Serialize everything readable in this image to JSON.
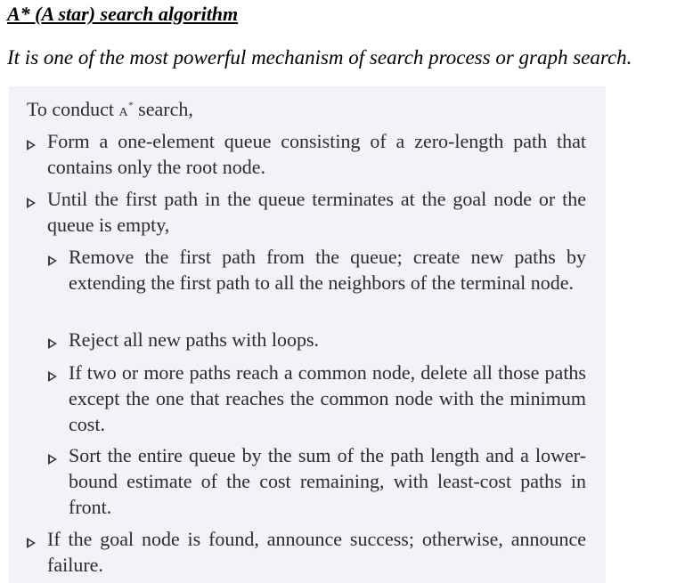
{
  "title": "A* (A star) search algorithm",
  "intro": "It is one of the most powerful mechanism of search process or graph search.",
  "procedure": {
    "heading_pre": "To conduct ",
    "heading_a": "A",
    "heading_star": "*",
    "heading_post": " search,",
    "steps": [
      "Form a one-element queue consisting of a zero-length path that contains only the root node.",
      "Until the first path in the queue terminates at the goal node or the queue is empty,",
      "Remove the first path from the queue; create new paths by extending the first path to all the neighbors of the terminal node.",
      "Reject all new paths with loops.",
      "If two or more paths reach a common node, delete all those paths except the one that reaches the common node with the minimum cost.",
      "Sort the entire queue by the sum of the path length and a lower-bound estimate of the cost remaining, with least-cost paths in front.",
      "If the goal node is found, announce success; otherwise, announce failure."
    ]
  }
}
